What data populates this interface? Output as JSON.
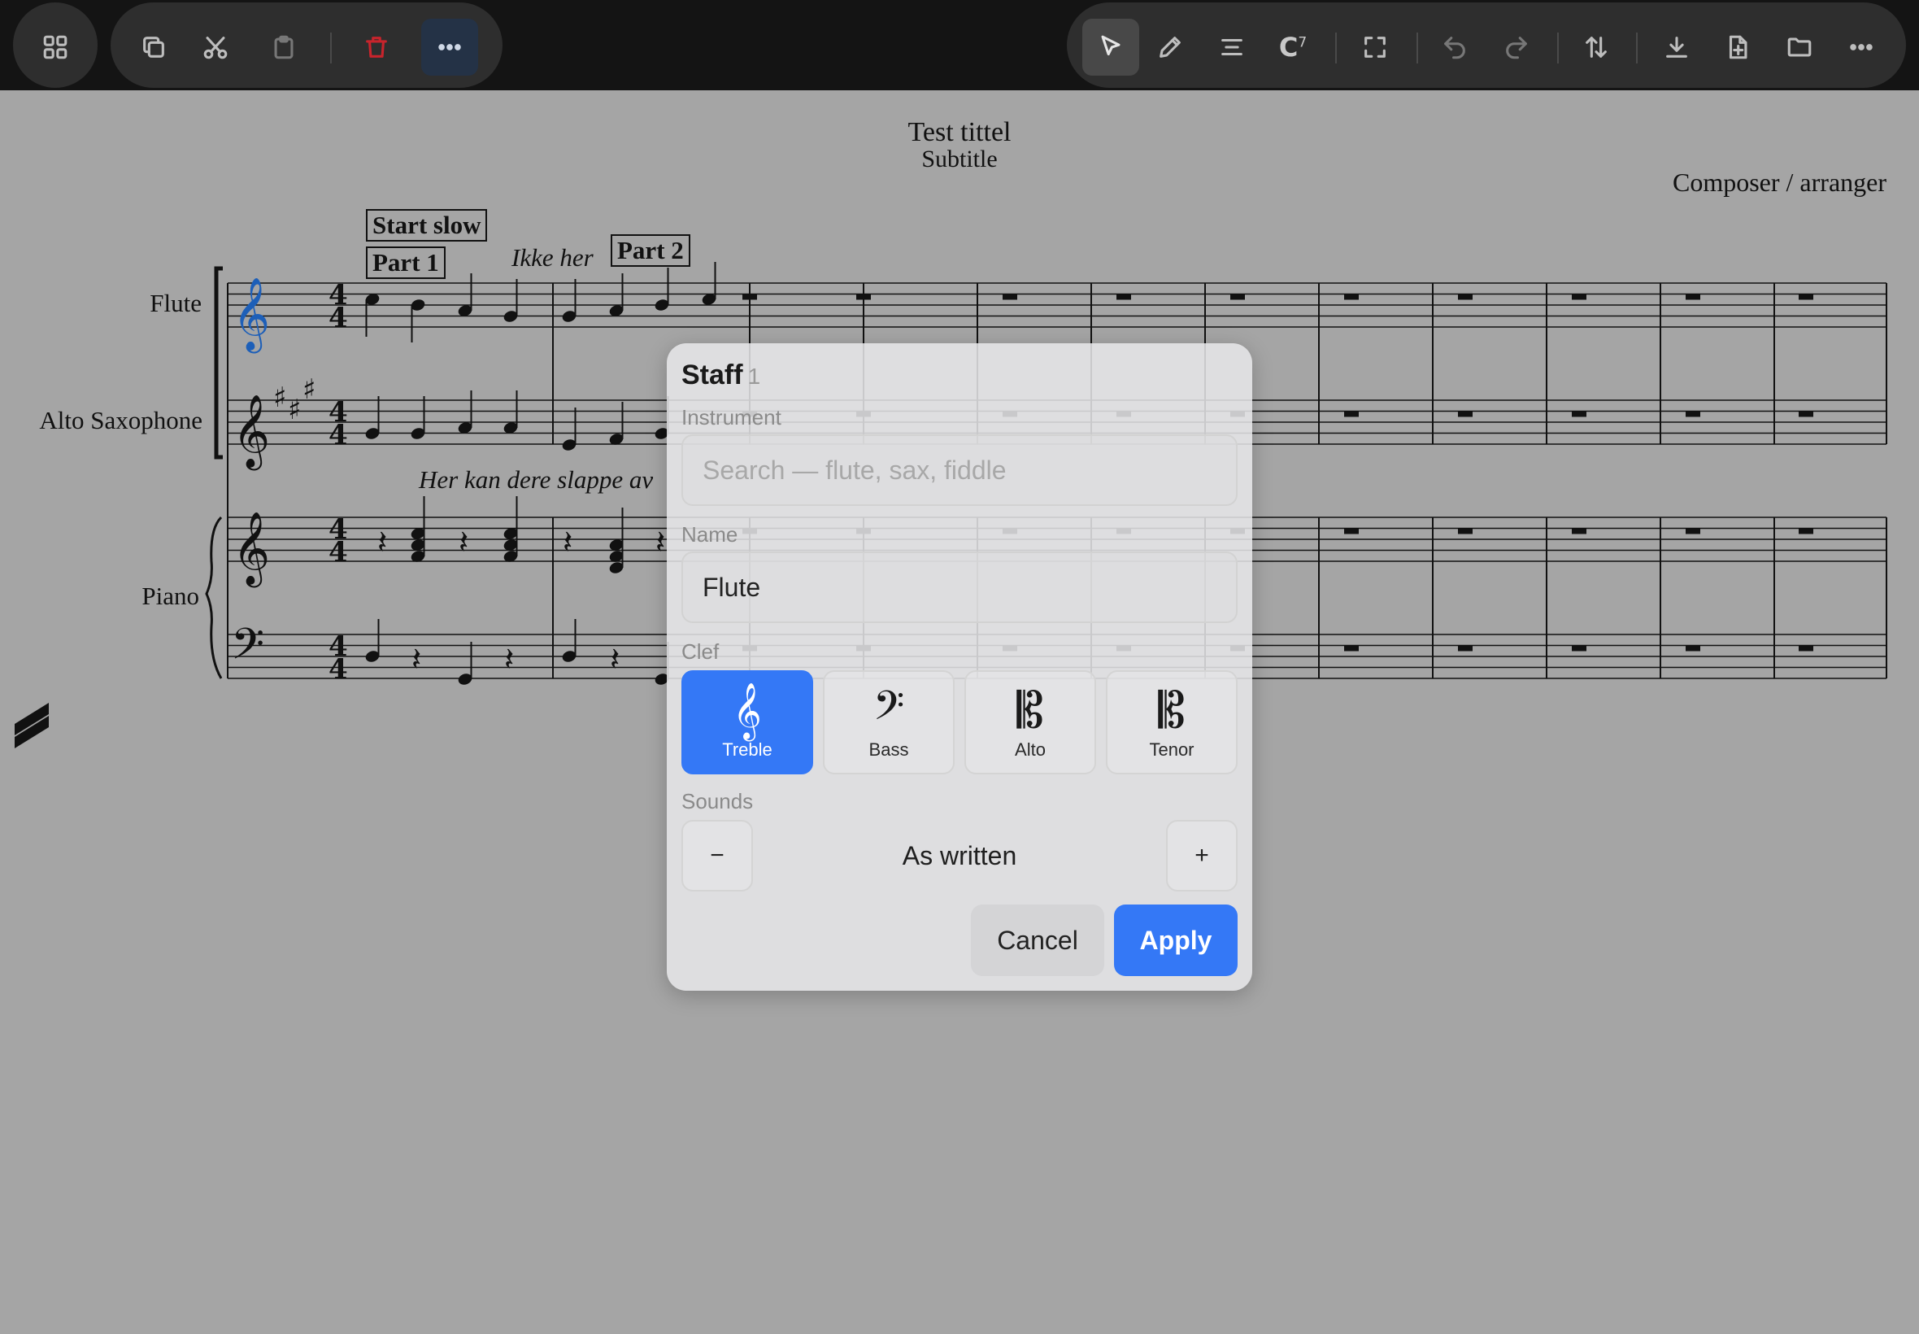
{
  "toolbar": {
    "left_icons": [
      "grid-icon",
      "copy-icon",
      "cut-icon",
      "paste-icon",
      "delete-icon",
      "more-icon"
    ],
    "right_icons": [
      "select-arrow-icon",
      "pencil-icon",
      "align-icon",
      "chord-symbol-icon",
      "fullscreen-icon",
      "undo-icon",
      "redo-icon",
      "sort-icon",
      "download-icon",
      "new-file-icon",
      "folder-icon",
      "more-icon"
    ],
    "chord_glyph": "C",
    "chord_sup": "7"
  },
  "score": {
    "title": "Test tittel",
    "subtitle": "Subtitle",
    "composer": "Composer / arranger",
    "rehearsal_marks": [
      "Start slow",
      "Part 1",
      "Part 2"
    ],
    "expressions": [
      "Ikke her",
      "Her kan dere slappe av"
    ],
    "instruments": [
      "Flute",
      "Alto Saxophone",
      "Piano"
    ],
    "time_signature": "4/4",
    "selected_staff_color": "#1d5fb8"
  },
  "dialog": {
    "title": "Staff",
    "staff_number": "1",
    "instrument_label": "Instrument",
    "instrument_placeholder": "Search — flute, sax, fiddle",
    "name_label": "Name",
    "name_value": "Flute",
    "clef_label": "Clef",
    "clefs": [
      {
        "label": "Treble",
        "icon": "treble-clef-icon",
        "selected": true
      },
      {
        "label": "Bass",
        "icon": "bass-clef-icon",
        "selected": false
      },
      {
        "label": "Alto",
        "icon": "alto-clef-icon",
        "selected": false
      },
      {
        "label": "Tenor",
        "icon": "tenor-clef-icon",
        "selected": false
      }
    ],
    "sounds_label": "Sounds",
    "sounds_value": "As written",
    "minus_label": "−",
    "plus_label": "+",
    "cancel_label": "Cancel",
    "apply_label": "Apply",
    "accent_color": "#3478f6"
  }
}
